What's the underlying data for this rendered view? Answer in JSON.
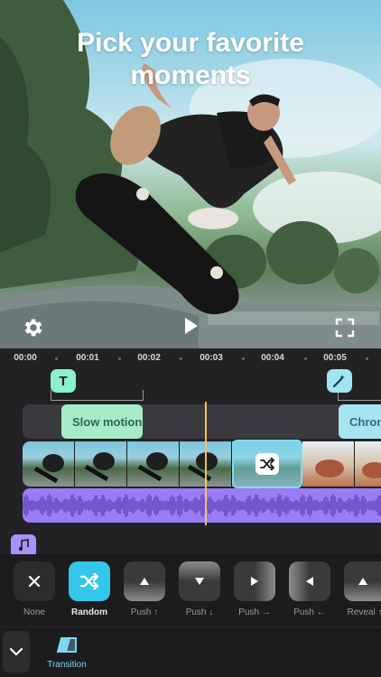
{
  "preview": {
    "headline_line1": "Pick your favorite",
    "headline_line2": "moments"
  },
  "timeline": {
    "ruler_labels": [
      "00:00",
      "00:01",
      "00:02",
      "00:03",
      "00:04",
      "00:05"
    ],
    "text_badge": "T",
    "effect_chips": {
      "slow_motion": "Slow motion",
      "chroma": "Chrom"
    }
  },
  "transitions": {
    "selected": "Random",
    "items": [
      "None",
      "Random",
      "Push ↑",
      "Push ↓",
      "Push →",
      "Push ←",
      "Reveal ↑"
    ]
  },
  "bottom_bar": {
    "active_tab": "Transition"
  },
  "colors": {
    "accent_cyan": "#35c6ec",
    "effect_green": "#a7ecc8",
    "effect_cyan": "#a6e4ef",
    "audio_purple": "#9a7cf4",
    "playhead": "#f2c05a"
  }
}
